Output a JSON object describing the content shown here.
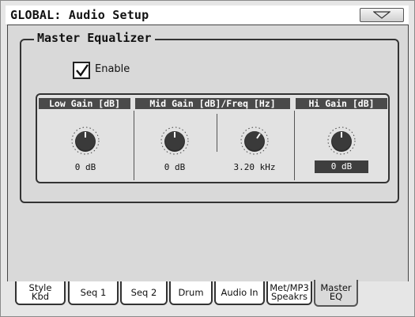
{
  "window": {
    "title": "GLOBAL: Audio Setup",
    "menu_icon": "triangle-down-icon"
  },
  "master_eq": {
    "group_title": "Master Equalizer",
    "enable_label": "Enable",
    "enable_checked": true,
    "headers": {
      "low": "Low Gain [dB]",
      "mid": "Mid Gain [dB]/Freq [Hz]",
      "hi": "Hi Gain [dB]"
    },
    "knobs": {
      "low_gain": "0 dB",
      "mid_gain": "0 dB",
      "mid_freq": "3.20 kHz",
      "hi_gain": "0 dB"
    }
  },
  "tabs": [
    {
      "label": "Style\nKbd"
    },
    {
      "label": "Seq 1"
    },
    {
      "label": "Seq 2"
    },
    {
      "label": "Drum"
    },
    {
      "label": "Audio In"
    },
    {
      "label": "Met/MP3\nSpeakrs"
    },
    {
      "label": "Master\nEQ",
      "active": true
    }
  ],
  "colors": {
    "background": "#e6e6e6",
    "header_bg": "#4a4a4a",
    "selected_value_bg": "#3e3e3e"
  }
}
